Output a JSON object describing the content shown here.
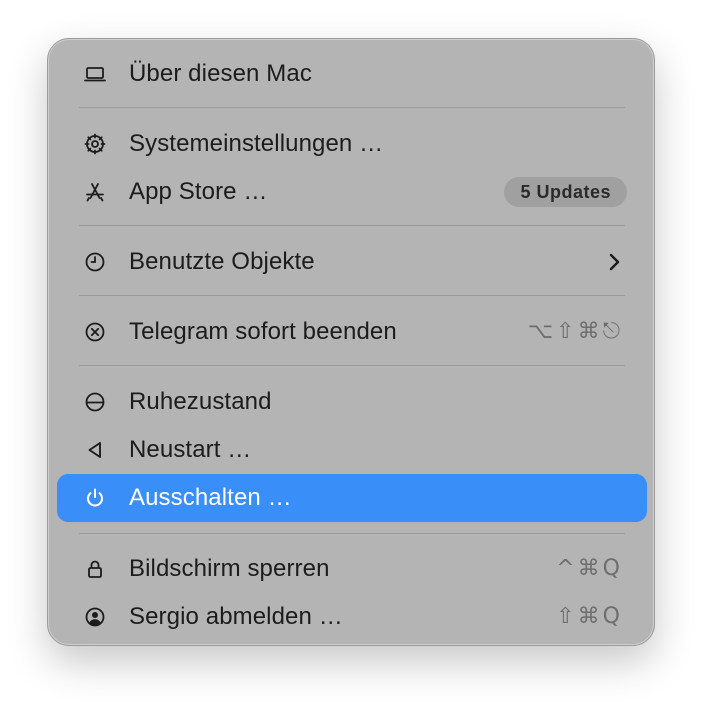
{
  "menu": {
    "items": [
      {
        "label": "Über diesen Mac",
        "icon": "laptop-icon"
      },
      {
        "label": "Systemeinstellungen …",
        "icon": "gear-icon"
      },
      {
        "label": "App Store …",
        "icon": "app-store-icon",
        "badge": "5 Updates"
      },
      {
        "label": "Benutzte Objekte",
        "icon": "clock-icon",
        "submenu": true
      },
      {
        "label": "Telegram sofort beenden",
        "icon": "force-quit-icon",
        "shortcut": "⌥⇧⌘⎋"
      },
      {
        "label": "Ruhezustand",
        "icon": "sleep-icon"
      },
      {
        "label": "Neustart …",
        "icon": "restart-icon"
      },
      {
        "label": "Ausschalten …",
        "icon": "power-icon",
        "highlighted": true
      },
      {
        "label": "Bildschirm sperren",
        "icon": "lock-icon",
        "shortcut": "^⌘Q"
      },
      {
        "label": "Sergio abmelden …",
        "icon": "user-icon",
        "shortcut": "⇧⌘Q"
      }
    ]
  },
  "colors": {
    "menu_background": "#b4b4b4",
    "highlight": "#3a8ef8",
    "badge_background": "#a0a0a0",
    "shortcut_text": "#6e6e6e"
  }
}
